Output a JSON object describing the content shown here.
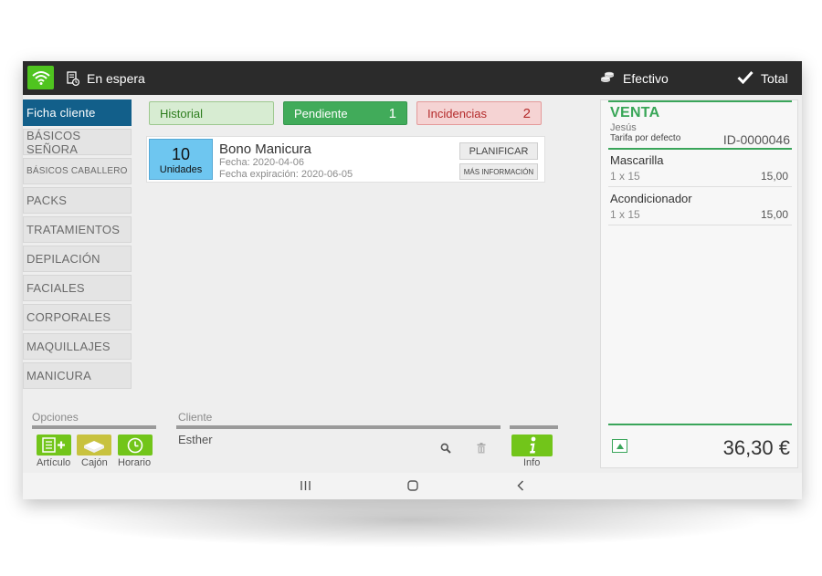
{
  "topbar": {
    "wifi_icon": "wifi-icon",
    "wait_icon": "receipt-clock-icon",
    "wait_label": "En espera",
    "payment_icon": "coins-icon",
    "payment_label": "Efectivo",
    "total_icon": "check-icon",
    "total_label": "Total",
    "accent_color": "#4fc41f"
  },
  "categories": [
    {
      "label": "Ficha cliente",
      "active": true
    },
    {
      "label": "BÁSICOS SEÑORA"
    },
    {
      "label": "BÁSICOS CABALLERO"
    },
    {
      "label": "PACKS"
    },
    {
      "label": "TRATAMIENTOS"
    },
    {
      "label": "DEPILACIÓN"
    },
    {
      "label": "FACIALES"
    },
    {
      "label": "CORPORALES"
    },
    {
      "label": "MAQUILLAJES"
    },
    {
      "label": "MANICURA"
    }
  ],
  "tabs": {
    "historial": {
      "label": "Historial"
    },
    "pendiente": {
      "label": "Pendiente",
      "count": "1"
    },
    "incidencias": {
      "label": "Incidencias",
      "count": "2"
    }
  },
  "bono": {
    "quantity": "10",
    "unit": "Unidades",
    "title": "Bono Manicura",
    "date": "Fecha: 2020-04-06",
    "expiry": "Fecha expiración: 2020-06-05",
    "plan_button": "PLANIFICAR",
    "more_button": "MÁS INFORMACIÓN"
  },
  "options": {
    "section_label": "Opciones",
    "buttons": [
      {
        "label": "Artículo",
        "icon": "add-article-icon",
        "color": "#72c51a"
      },
      {
        "label": "Cajón",
        "icon": "cash-drawer-icon",
        "color": "#c8c23e"
      },
      {
        "label": "Horario",
        "icon": "clock-icon",
        "color": "#72c51a"
      }
    ]
  },
  "client": {
    "section_label": "Cliente",
    "name": "Esther",
    "search_icon": "search-icon",
    "delete_icon": "trash-icon"
  },
  "info": {
    "label": "Info",
    "icon": "info-icon"
  },
  "sale": {
    "title": "VENTA",
    "client": "Jesús",
    "tarifa": "Tarifa por defecto",
    "id": "ID-0000046",
    "items": [
      {
        "name": "Mascarilla",
        "qty": "1 x 15",
        "price": "15,00"
      },
      {
        "name": "Acondicionador",
        "qty": "1 x 15",
        "price": "15,00"
      }
    ],
    "total": "36,30 €",
    "accent_color": "#38a657"
  },
  "navbar": {
    "recent_icon": "recent-apps-icon",
    "home_icon": "home-icon",
    "back_icon": "back-icon"
  }
}
